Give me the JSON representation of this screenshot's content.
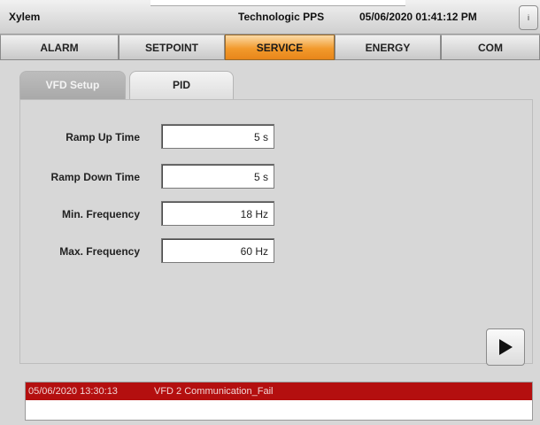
{
  "header": {
    "title": "Xylem",
    "app_name": "Technologic PPS",
    "datetime": "05/06/2020 01:41:12 PM",
    "info_label": "i"
  },
  "nav": {
    "items": [
      {
        "label": "ALARM"
      },
      {
        "label": "SETPOINT"
      },
      {
        "label": "SERVICE",
        "active": true
      },
      {
        "label": "ENERGY"
      },
      {
        "label": "COM"
      }
    ]
  },
  "tabs": [
    {
      "label": "VFD Setup",
      "active": true
    },
    {
      "label": "PID"
    }
  ],
  "fields": [
    {
      "label": "Ramp Up Time",
      "value": "5 s"
    },
    {
      "label": "Ramp Down Time",
      "value": "5 s"
    },
    {
      "label": "Min. Frequency",
      "value": "18 Hz"
    },
    {
      "label": "Max. Frequency",
      "value": "60 Hz"
    }
  ],
  "play_button": {
    "icon": "play-icon"
  },
  "alarm": {
    "timestamp": "05/06/2020 13:30:13",
    "message": "VFD 2 Communication_Fail",
    "color": "#b40f0f"
  },
  "colors": {
    "active_nav": "#f29a2c",
    "background": "#d7d7d7"
  }
}
